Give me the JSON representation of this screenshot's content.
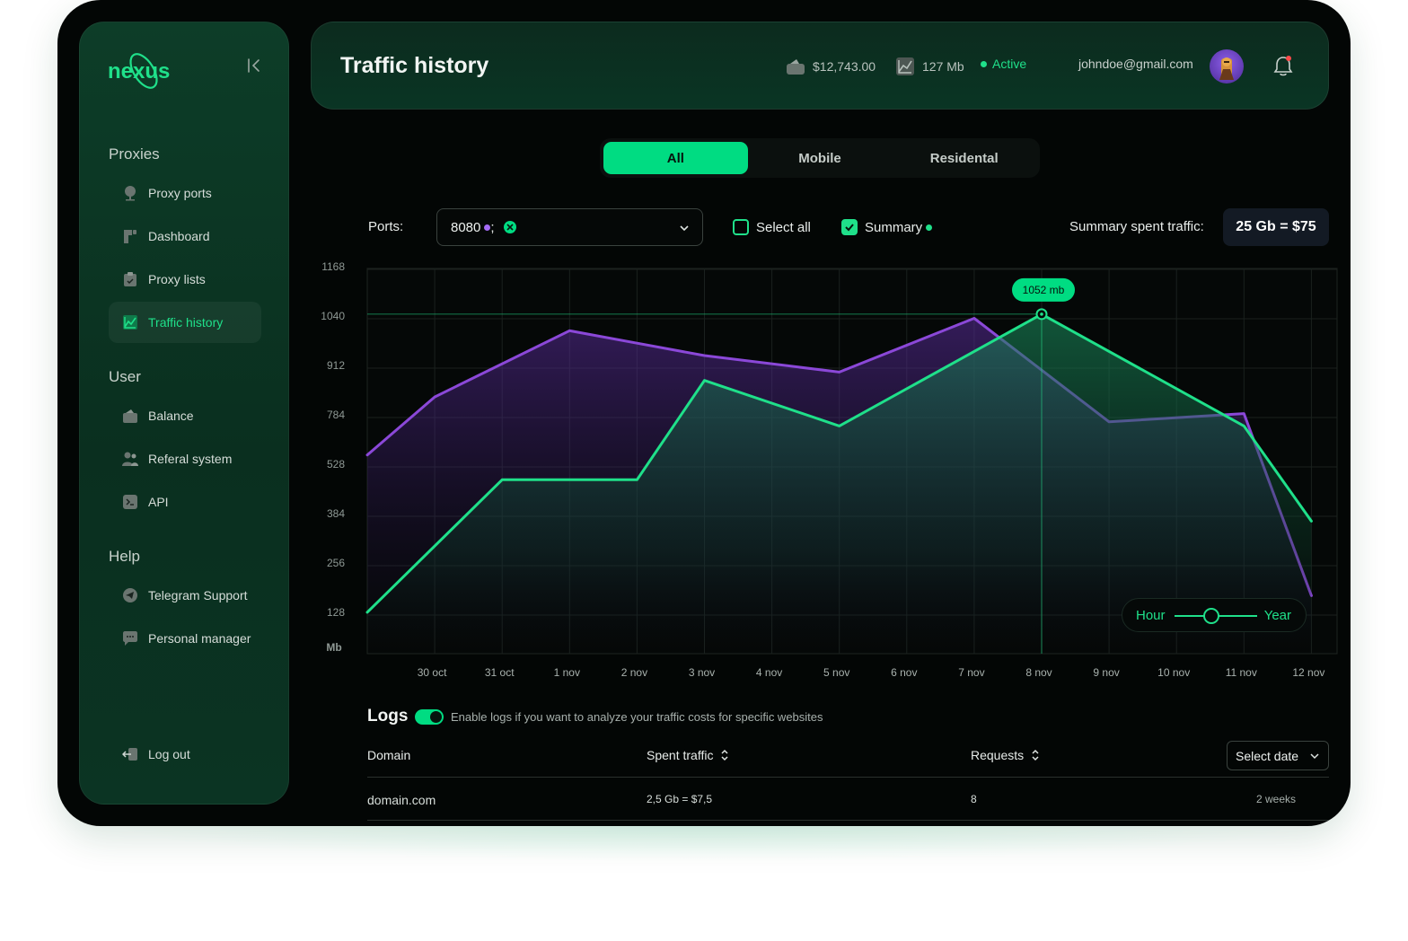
{
  "app": {
    "logo": "nexus"
  },
  "sidebar": {
    "sections": [
      {
        "title": "Proxies",
        "items": [
          {
            "label": "Proxy ports",
            "icon": "tree-icon"
          },
          {
            "label": "Dashboard",
            "icon": "dashboard-icon"
          },
          {
            "label": "Proxy lists",
            "icon": "clipboard-icon"
          },
          {
            "label": "Traffic history",
            "icon": "chart-icon",
            "active": true
          }
        ]
      },
      {
        "title": "User",
        "items": [
          {
            "label": "Balance",
            "icon": "wallet-icon"
          },
          {
            "label": "Referal system",
            "icon": "users-icon"
          },
          {
            "label": "API",
            "icon": "terminal-icon"
          }
        ]
      },
      {
        "title": "Help",
        "items": [
          {
            "label": "Telegram Support",
            "icon": "telegram-icon"
          },
          {
            "label": "Personal manager",
            "icon": "chat-icon"
          }
        ]
      }
    ],
    "logout": "Log out"
  },
  "header": {
    "title": "Traffic history",
    "balance": "$12,743.00",
    "traffic": "127 Mb",
    "status": "Active",
    "email": "johndoe@gmail.com"
  },
  "tabs": [
    {
      "label": "All",
      "active": true
    },
    {
      "label": "Mobile",
      "active": false
    },
    {
      "label": "Residental",
      "active": false
    }
  ],
  "controls": {
    "ports_label": "Ports:",
    "ports_value": "8080",
    "ports_separator": ";",
    "select_all": "Select all",
    "select_all_checked": false,
    "summary": "Summary",
    "summary_checked": true,
    "summary_spent_label": "Summary spent traffic:",
    "summary_spent_value": "25 Gb = $75"
  },
  "chart_data": {
    "type": "area",
    "x": [
      "",
      "30 oct",
      "31 oct",
      "1 nov",
      "2 nov",
      "3 nov",
      "4 nov",
      "5 nov",
      "6 nov",
      "7 nov",
      "8 nov",
      "9 nov",
      "10 nov",
      "11 nov",
      "12 nov"
    ],
    "x_tick_labels": [
      "30 oct",
      "31 oct",
      "1 nov",
      "2 nov",
      "3 nov",
      "4 nov",
      "5 nov",
      "6 nov",
      "7 nov",
      "8 nov",
      "9 nov",
      "10 nov",
      "11 nov",
      "12 nov"
    ],
    "y_ticks": [
      "1168",
      "1040",
      "912",
      "784",
      "528",
      "384",
      "256",
      "128"
    ],
    "ylabel": "Mb",
    "series": [
      {
        "color": "#8b48d8",
        "points": [
          [
            0,
            4.8
          ],
          [
            1,
            6.2
          ],
          [
            3,
            7.8
          ],
          [
            4,
            7.5
          ],
          [
            5,
            7.2
          ],
          [
            7,
            6.8
          ],
          [
            9,
            8.1
          ],
          [
            11,
            5.6
          ],
          [
            13,
            5.8
          ],
          [
            14,
            1.4
          ]
        ]
      },
      {
        "color": "#1fe08a",
        "points": [
          [
            0,
            1.0
          ],
          [
            2,
            4.2
          ],
          [
            4,
            4.2
          ],
          [
            5,
            6.6
          ],
          [
            7,
            5.5
          ],
          [
            10,
            8.2
          ],
          [
            13,
            5.5
          ],
          [
            14,
            3.2
          ]
        ]
      }
    ],
    "highlight": {
      "x": "8 nov",
      "label": "1052 mb"
    },
    "grid": true,
    "range": {
      "min_label": "Hour",
      "max_label": "Year"
    }
  },
  "logs": {
    "title": "Logs",
    "enabled": true,
    "hint": "Enable logs if you want to analyze your traffic costs for specific websites",
    "columns": [
      "Domain",
      "Spent traffic",
      "Requests"
    ],
    "date_select": "Select date",
    "rows": [
      {
        "domain": "domain.com",
        "spent": "2,5 Gb = $7,5",
        "requests": "8",
        "when": "2 weeks"
      }
    ]
  }
}
